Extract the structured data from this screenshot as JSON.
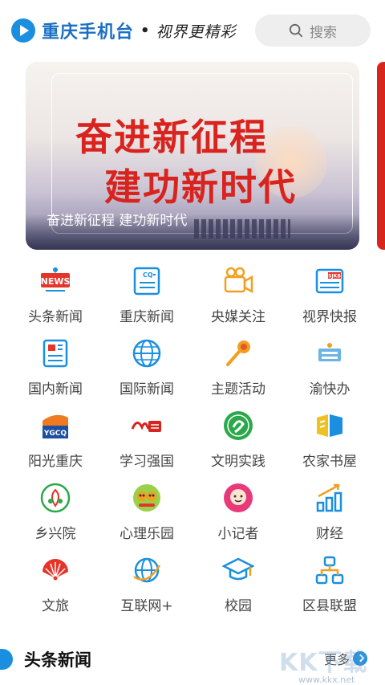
{
  "header": {
    "app_name": "重庆手机台",
    "separator": "•",
    "slogan": "视界更精彩",
    "search_placeholder": "搜索"
  },
  "banner": {
    "headline_line1": "奋进新征程",
    "headline_line2": "建功新时代",
    "caption": "奋进新征程 建功新时代"
  },
  "grid": {
    "items": [
      {
        "label": "头条新闻",
        "icon": "news-icon"
      },
      {
        "label": "重庆新闻",
        "icon": "cq-document-icon"
      },
      {
        "label": "央媒关注",
        "icon": "video-camera-icon"
      },
      {
        "label": "视界快报",
        "icon": "sjkb-newspaper-icon"
      },
      {
        "label": "国内新闻",
        "icon": "newspaper-icon"
      },
      {
        "label": "国际新闻",
        "icon": "globe-icon"
      },
      {
        "label": "主题活动",
        "icon": "microphone-icon"
      },
      {
        "label": "渝快办",
        "icon": "yukuaiban-logo-icon"
      },
      {
        "label": "阳光重庆",
        "icon": "ygcq-logo-icon"
      },
      {
        "label": "学习强国",
        "icon": "xuexi-qiangguo-logo-icon"
      },
      {
        "label": "文明实践",
        "icon": "civilization-badge-icon"
      },
      {
        "label": "农家书屋",
        "icon": "book-house-icon"
      },
      {
        "label": "乡兴院",
        "icon": "rural-emblem-icon"
      },
      {
        "label": "心理乐园",
        "icon": "psychology-garden-icon"
      },
      {
        "label": "小记者",
        "icon": "young-reporter-icon"
      },
      {
        "label": "财经",
        "icon": "growth-chart-icon"
      },
      {
        "label": "文旅",
        "icon": "fan-icon"
      },
      {
        "label": "互联网+",
        "icon": "internet-plus-icon"
      },
      {
        "label": "校园",
        "icon": "graduation-cap-icon"
      },
      {
        "label": "区县联盟",
        "icon": "network-tree-icon"
      }
    ]
  },
  "section": {
    "title": "头条新闻",
    "more_label": "更多"
  },
  "watermark": {
    "text": "KK下载",
    "url": "www.kkx.net"
  },
  "colors": {
    "brand_blue": "#1a8fe0",
    "banner_red": "#d8231e"
  }
}
